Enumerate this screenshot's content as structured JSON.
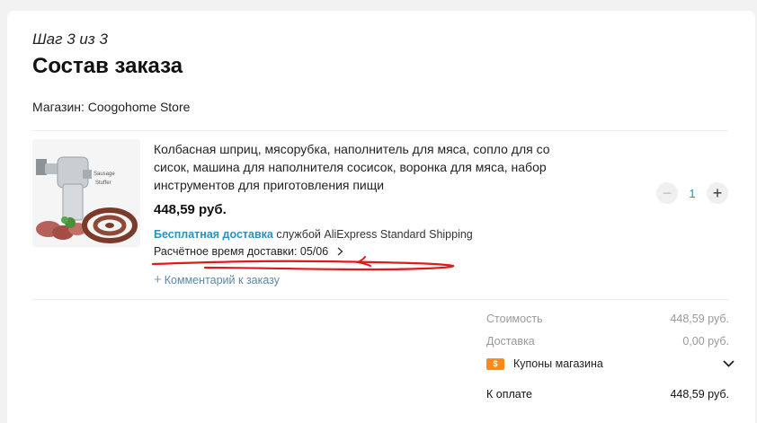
{
  "header": {
    "step": "Шаг 3 из 3",
    "title": "Состав заказа",
    "store": "Магазин: Coogohome Store"
  },
  "product": {
    "name": "Колбасная шприц, мясорубка, наполнитель для мяса, сопло для со сисок, машина для наполнителя сосисок, воронка для мяса, набор инструментов для приготовления пищи",
    "image_text_1": "Sausage",
    "image_text_2": "Stuffer",
    "price": "448,59 руб.",
    "shipping_free": "Бесплатная доставка",
    "shipping_service": "службой AliExpress Standard Shipping",
    "eta": "Расчётное время доставки: 05/06",
    "comment": "Комментарий к заказу",
    "quantity": "1",
    "minus": "−",
    "plus": "+"
  },
  "summary": {
    "cost_label": "Стоимость",
    "cost_value": "448,59 руб.",
    "delivery_label": "Доставка",
    "delivery_value": "0,00 руб.",
    "coupon_label": "Купоны магазина",
    "total_label": "К оплате",
    "total_value": "448,59 руб."
  },
  "colors": {
    "accent_blue": "#2a8fc1",
    "coupon_orange": "#ff8a1c",
    "annotation_red": "#e01919"
  }
}
